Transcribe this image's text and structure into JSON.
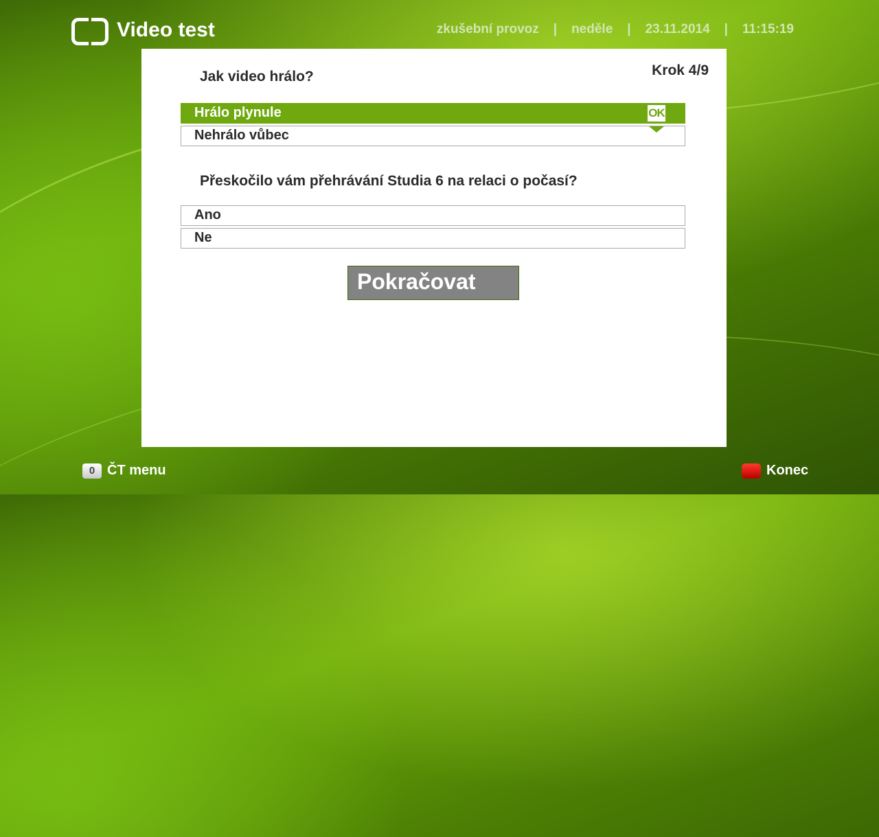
{
  "header": {
    "app_title": "Video test",
    "status_mode": "zkušební provoz",
    "separator": "|",
    "day": "neděle",
    "date": "23.11.2014",
    "time": "11:15:19"
  },
  "panel": {
    "step": "Krok 4/9",
    "question1": {
      "text": "Jak video hrálo?",
      "options": [
        {
          "label": "Hrálo plynule",
          "selected": true
        },
        {
          "label": "Nehrálo vůbec",
          "selected": false
        }
      ],
      "ok_badge": "OK"
    },
    "question2": {
      "text": "Přeskočilo vám přehrávání Studia 6 na relaci o počasí?",
      "options": [
        {
          "label": "Ano",
          "selected": false
        },
        {
          "label": "Ne",
          "selected": false
        }
      ]
    },
    "continue_label": "Pokračovat"
  },
  "footer": {
    "menu_key": "0",
    "menu_label": "ČT menu",
    "exit_label": "Konec"
  },
  "colors": {
    "accent_green": "#6fa80f",
    "button_gray": "#838383",
    "exit_red": "#d40000"
  },
  "icons": {
    "logo": "ct-logo-icon",
    "dropdown": "triangle-down-icon",
    "red_key": "red-button-icon"
  }
}
